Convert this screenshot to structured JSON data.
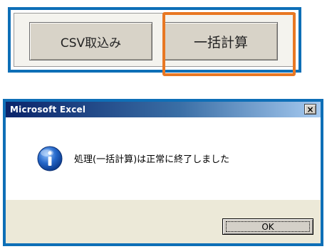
{
  "toolbar": {
    "csv_button_label": "CSV取込み",
    "batch_calc_button_label": "一括計算",
    "frame_color": "#0e6fb7",
    "highlight_color": "#e87722"
  },
  "dialog": {
    "title": "Microsoft Excel",
    "close_label": "×",
    "icon": "info-icon",
    "message": "処理(一括計算)は正常に終了しました",
    "ok_label": "OK"
  }
}
